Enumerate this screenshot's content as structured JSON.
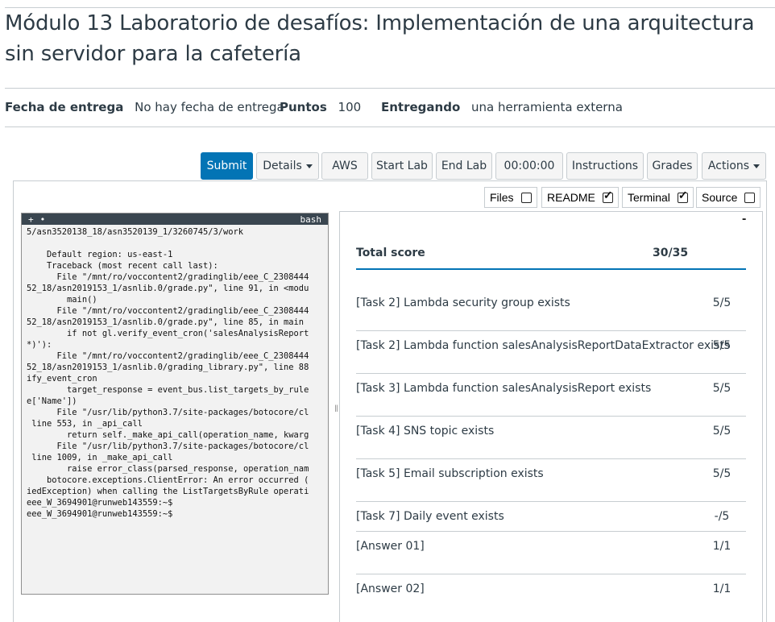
{
  "page": {
    "title": "Módulo 13 Laboratorio de desafíos: Implementación de una arquitectura sin servidor para la cafetería"
  },
  "meta": {
    "due_label": "Fecha de entrega",
    "due_value": "No hay fecha de entrega",
    "points_label": "Puntos",
    "points_value": "100",
    "submitting_label": "Entregando",
    "submitting_value": "una herramienta externa"
  },
  "toolbar": {
    "submit": "Submit",
    "details": "Details",
    "aws": "AWS",
    "start_lab": "Start Lab",
    "end_lab": "End Lab",
    "timer": "00:00:00",
    "instructions": "Instructions",
    "grades": "Grades",
    "actions": "Actions"
  },
  "toggles": [
    {
      "label": "Files",
      "checked": false
    },
    {
      "label": "README",
      "checked": true
    },
    {
      "label": "Terminal",
      "checked": true
    },
    {
      "label": "Source",
      "checked": false
    }
  ],
  "terminal": {
    "bar_plus": "+",
    "bar_dot": "•",
    "shell": "bash",
    "lines": [
      "5/asn3520138_18/asn3520139_1/3260745/3/work",
      "",
      "    Default region: us-east-1",
      "    Traceback (most recent call last):",
      "      File \"/mnt/ro/voccontent2/gradinglib/eee_C_2308444",
      "52_18/asn2019153_1/asnlib.0/grade.py\", line 91, in <modu",
      "        main()",
      "      File \"/mnt/ro/voccontent2/gradinglib/eee_C_2308444",
      "52_18/asn2019153_1/asnlib.0/grade.py\", line 85, in main",
      "        if not gl.verify_event_cron('salesAnalysisReport",
      "*)'):",
      "      File \"/mnt/ro/voccontent2/gradinglib/eee_C_2308444",
      "52_18/asn2019153_1/asnlib.0/grading_library.py\", line 88",
      "ify_event_cron",
      "        target_response = event_bus.list_targets_by_rule",
      "e['Name'])",
      "      File \"/usr/lib/python3.7/site-packages/botocore/cl",
      " line 553, in _api_call",
      "        return self._make_api_call(operation_name, kwarg",
      "      File \"/usr/lib/python3.7/site-packages/botocore/cl",
      " line 1009, in _make_api_call",
      "        raise error_class(parsed_response, operation_nam",
      "    botocore.exceptions.ClientError: An error occurred (",
      "iedException) when calling the ListTargetsByRule operati",
      "eee_W_3694901@runweb143559:~$",
      "eee_W_3694901@runweb143559:~$"
    ]
  },
  "grades": {
    "collapse": "-",
    "total_label": "Total score",
    "total_score": "30/35",
    "rows": [
      {
        "label": "[Task 2] Lambda security group exists",
        "score": "5/5"
      },
      {
        "label": "[Task 2] Lambda function salesAnalysisReportDataExtractor exists",
        "score": "5/5"
      },
      {
        "label": "[Task 3] Lambda function salesAnalysisReport exists",
        "score": "5/5"
      },
      {
        "label": "[Task 4] SNS topic exists",
        "score": "5/5"
      },
      {
        "label": "[Task 5] Email subscription exists",
        "score": "5/5"
      },
      {
        "label": "[Task 7] Daily event exists",
        "score": "-/5"
      },
      {
        "label": "[Answer 01]",
        "score": "1/1"
      },
      {
        "label": "[Answer 02]",
        "score": "1/1"
      }
    ]
  },
  "colors": {
    "primary": "#0374b5",
    "text": "#2d3b45",
    "border": "#c7cdd1"
  }
}
